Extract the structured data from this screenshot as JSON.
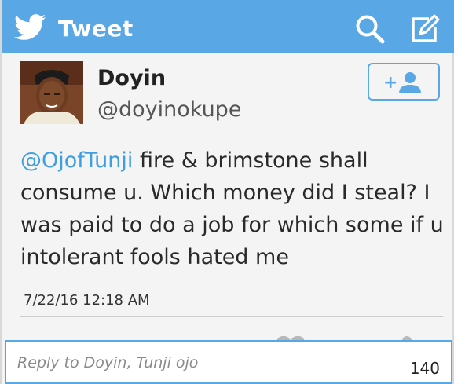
{
  "header": {
    "title": "Tweet",
    "bird_icon": "twitter-bird-icon",
    "search_icon": "search-icon",
    "compose_icon": "compose-icon",
    "color": "#5aa7e6"
  },
  "profile": {
    "name": "Doyin",
    "handle": "@doyinokupe",
    "follow_icon": "add-user-icon",
    "follow_label": "+"
  },
  "tweet": {
    "mention": "@OjofTunji",
    "text": " fire & brimstone shall consume u. Which money did I steal? I was paid to do a job for which some if u intolerant fools hated me",
    "timestamp": "7/22/16 12:18 AM",
    "mention_color": "#3f9ee0"
  },
  "reply": {
    "placeholder": "Reply to Doyin, Tunji ojo",
    "char_count": "140"
  }
}
